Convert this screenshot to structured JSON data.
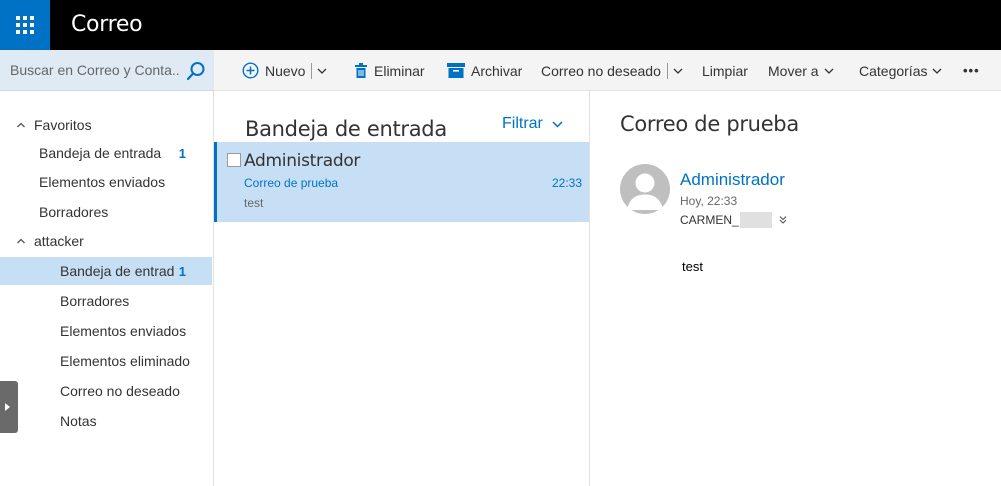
{
  "app": {
    "title": "Correo"
  },
  "search": {
    "placeholder": "Buscar en Correo y Conta..."
  },
  "toolbar": {
    "nuevo": "Nuevo",
    "eliminar": "Eliminar",
    "archivar": "Archivar",
    "correo_no_deseado": "Correo no deseado",
    "limpiar": "Limpiar",
    "mover_a": "Mover a",
    "categorias": "Categorías",
    "more": "•••"
  },
  "nav": {
    "favorites_label": "Favoritos",
    "favorites": [
      {
        "label": "Bandeja de entrada",
        "count": "1"
      },
      {
        "label": "Elementos enviados",
        "count": ""
      },
      {
        "label": "Borradores",
        "count": ""
      }
    ],
    "account_label": "attacker",
    "folders": [
      {
        "label": "Bandeja de entrad",
        "count": "1"
      },
      {
        "label": "Borradores",
        "count": ""
      },
      {
        "label": "Elementos enviados",
        "count": ""
      },
      {
        "label": "Elementos eliminado",
        "count": ""
      },
      {
        "label": "Correo no deseado",
        "count": ""
      },
      {
        "label": "Notas",
        "count": ""
      }
    ]
  },
  "list": {
    "title": "Bandeja de entrada",
    "filter_label": "Filtrar",
    "messages": [
      {
        "sender": "Administrador",
        "subject": "Correo de prueba",
        "time": "22:33",
        "preview": "test"
      }
    ]
  },
  "reading": {
    "subject": "Correo de prueba",
    "sender": "Administrador",
    "date": "Hoy, 22:33",
    "to": "CARMEN_",
    "body": "test"
  },
  "colors": {
    "accent": "#0072c6",
    "selected_bg": "#c7dff4",
    "topbar_bg": "#000000",
    "search_bg": "#dfeaf5",
    "toolbar_bg": "#f4f4f4"
  }
}
